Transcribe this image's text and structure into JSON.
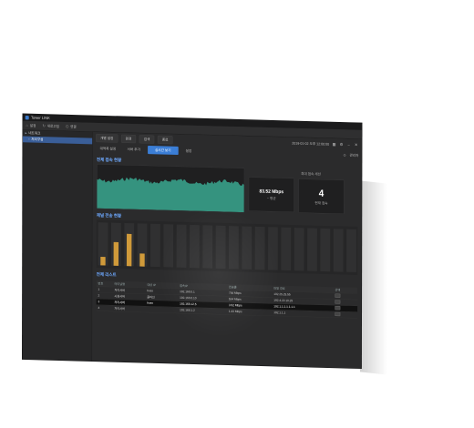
{
  "window": {
    "title": "Tower LINK"
  },
  "toolbar": {
    "items": [
      {
        "icon": "home-icon",
        "label": "설정"
      },
      {
        "icon": "refresh-icon",
        "label": "새로고침"
      },
      {
        "icon": "power-icon",
        "label": "연결"
      }
    ]
  },
  "sidebar": {
    "items": [
      {
        "icon": "folder-icon",
        "label": "네트워크"
      },
      {
        "icon": "monitor-icon",
        "label": "처리구성"
      }
    ]
  },
  "tabs_row1": [
    "개별 설정",
    "환경",
    "검색",
    "종료"
  ],
  "tabs_row2": {
    "items": [
      "대역폭 설정",
      "서버 추가"
    ],
    "primary": "실시간 보기",
    "secondary": "설정"
  },
  "status": {
    "datetime": "2019-01-02 오후 12:00:00",
    "user": "관리자"
  },
  "realtime": {
    "title": "전체 접속 현황",
    "kpi1": {
      "value": "83.52 Mbps",
      "sub": "~ 평균"
    },
    "kpi2": {
      "label": "최대 접속 세션",
      "value": "4",
      "sub": "현재 접속"
    }
  },
  "bars_section": {
    "title": "채널 전송 현황",
    "values": [
      0.2,
      0.55,
      0.75,
      0.3,
      0,
      0,
      0,
      0,
      0,
      0,
      0,
      0,
      0,
      0,
      0,
      0,
      0,
      0,
      0,
      0
    ]
  },
  "list": {
    "title": "전체 리스트",
    "headers": [
      "번호",
      "터미널명",
      "대상 IP",
      "접속IP",
      "전송률",
      "파일 경로",
      "선택"
    ],
    "rows": [
      [
        "1",
        "처리서버",
        "hoss",
        "192.168.0.1",
        "754 Mbps",
        "192.25.25.55",
        ""
      ],
      [
        "2",
        "시퀀서버",
        "클라인",
        "192.168.0.10",
        "534 Mbps",
        "192.4.22.10.25",
        ""
      ],
      [
        "3",
        "처리서버",
        "hoss",
        "192.168.12.5",
        "3.52 Mbps",
        "192.1.1.1.1.1.1.1",
        ""
      ],
      [
        "4",
        "처리서버",
        "",
        "192.168.1.2",
        "1.43 Mbps",
        "192.1.1.1",
        ""
      ]
    ]
  },
  "colors": {
    "accent": "#3b7ed6",
    "chart": "#3aa890",
    "bars": "#d09a3a"
  }
}
